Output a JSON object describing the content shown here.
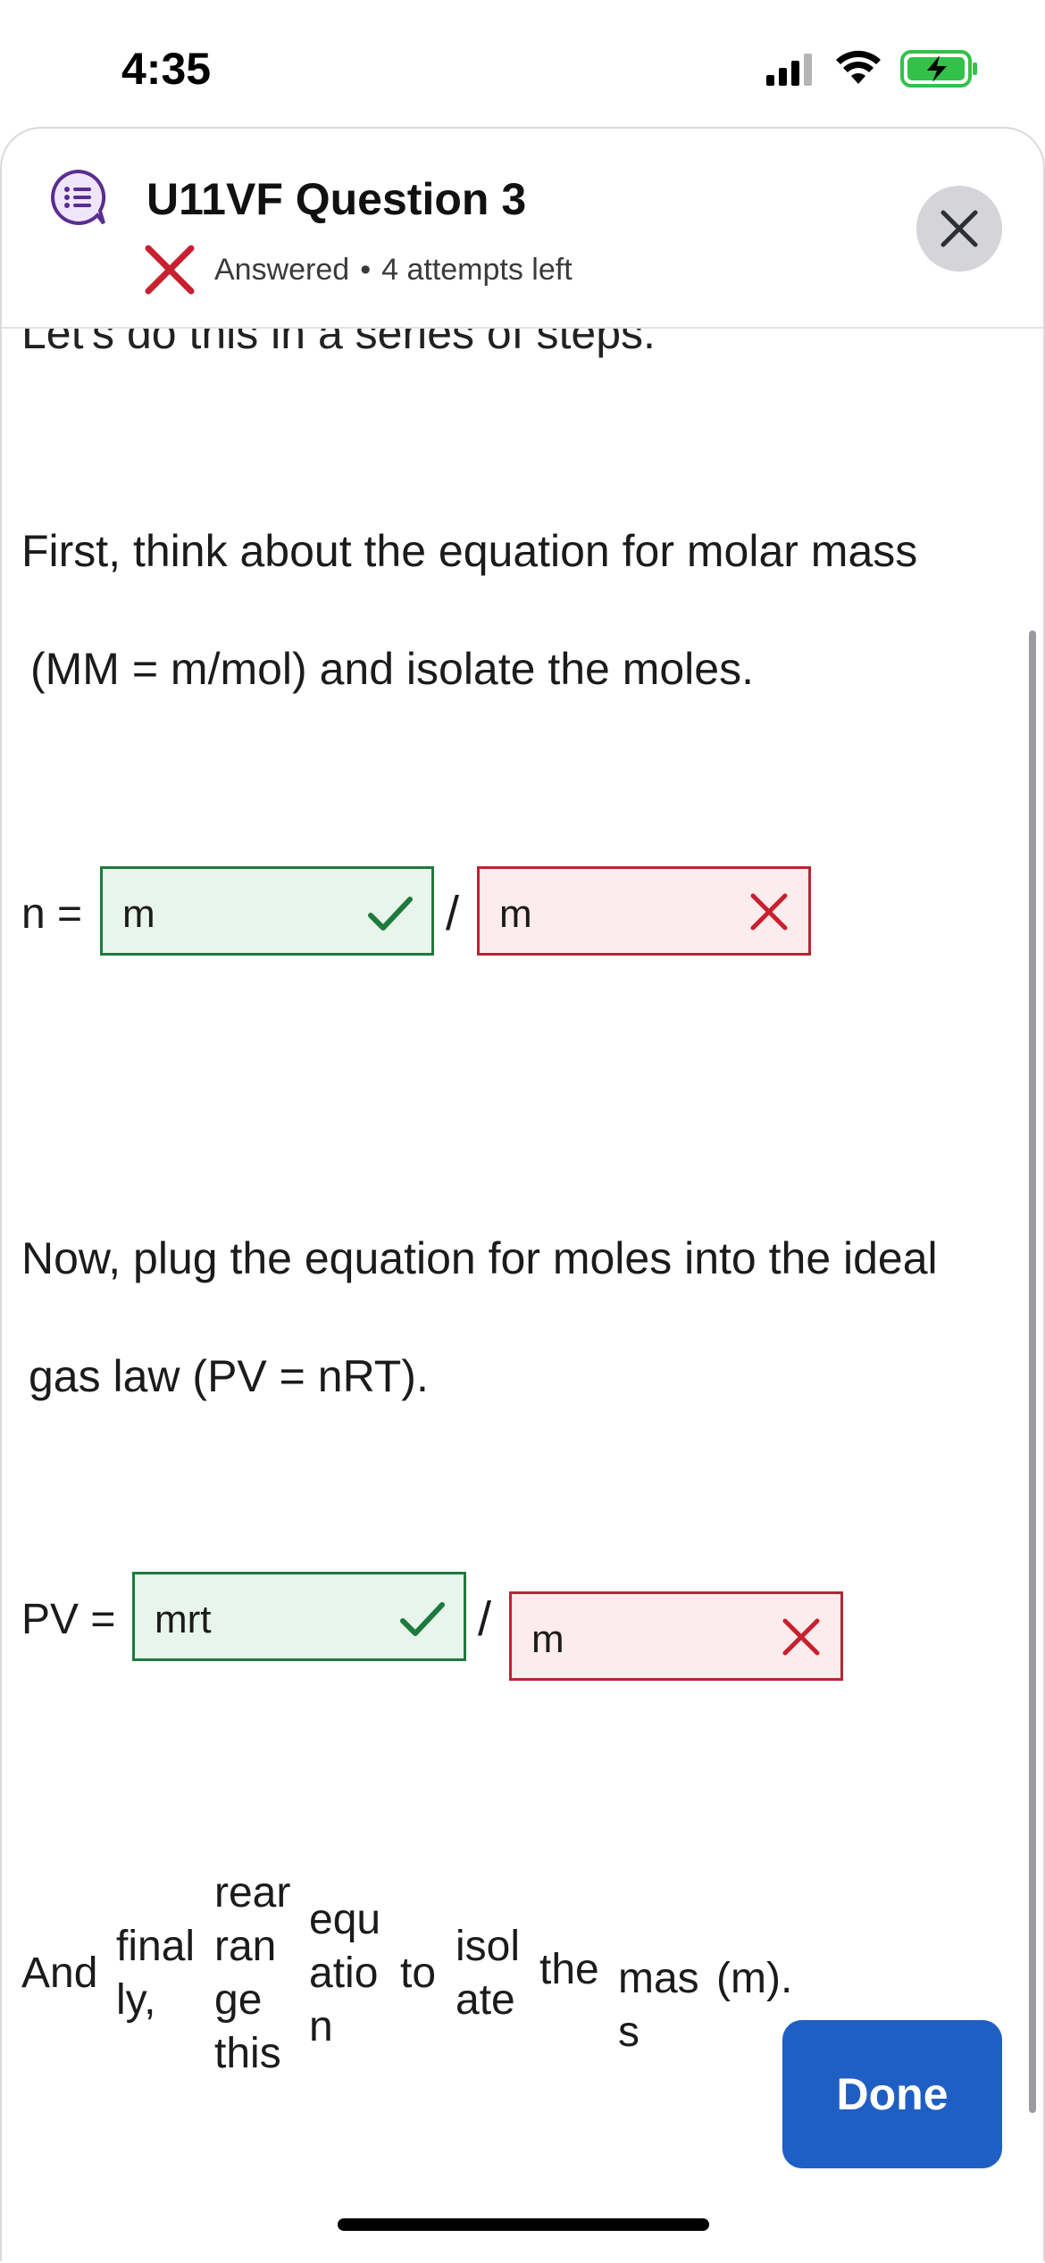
{
  "status_bar": {
    "time": "4:35"
  },
  "header": {
    "title": "U11VF Question 3",
    "status": "Answered",
    "separator": "•",
    "attempts": "4 attempts left"
  },
  "content": {
    "cut_intro": "Let's do this in a series of steps.",
    "para1_line1": "First, think about the equation for molar mass",
    "para1_line2": "(MM = m/mol) and isolate the moles.",
    "eq1": {
      "label": "n =",
      "numerator": "m",
      "slash": "/",
      "denominator": "m"
    },
    "para2_line1": "Now, plug the equation for moles into the ideal",
    "para2_line2": "gas law (PV = nRT).",
    "eq2": {
      "label": "PV =",
      "numerator": "mrt",
      "slash": "/",
      "denominator": "m"
    },
    "wrapped_words": {
      "w1": "And",
      "w2a": "final",
      "w2b": "ly,",
      "w3a": "rear",
      "w3b": "ran",
      "w3c": "ge",
      "w3d": "this",
      "w4a": "equ",
      "w4b": "atio",
      "w4c": "n",
      "w5": "to",
      "w6a": "isol",
      "w6b": "ate",
      "w7": "the",
      "w8a": "mas",
      "w8b": "s",
      "w9": "(m)."
    }
  },
  "done_button": "Done",
  "colors": {
    "correct": "#1e7a3c",
    "incorrect": "#b52633",
    "primary": "#1f5fc4",
    "accent": "#5b2d91"
  },
  "icons": [
    "signal-icon",
    "wifi-icon",
    "battery-charging-icon",
    "question-list-icon",
    "incorrect-x-icon",
    "close-icon",
    "checkmark-icon"
  ]
}
